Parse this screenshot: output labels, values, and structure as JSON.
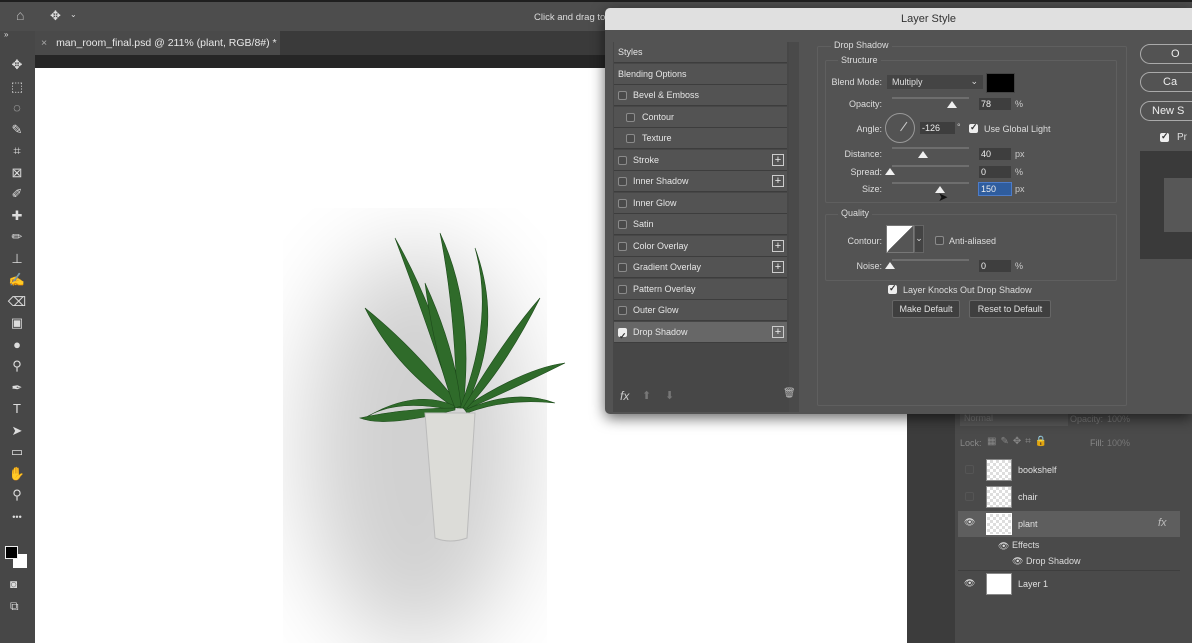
{
  "topbar": {
    "hint": "Click and drag to",
    "icons": [
      "home-icon",
      "move-icon",
      "chevron-down-icon"
    ]
  },
  "document_tab": {
    "close": "×",
    "title": "man_room_final.psd @ 211% (plant, RGB/8#) *"
  },
  "toolbar": {
    "expand": "»",
    "tools": [
      {
        "name": "move-tool",
        "glyph": "✥"
      },
      {
        "name": "marquee-tool",
        "glyph": "⬚"
      },
      {
        "name": "lasso-tool",
        "glyph": "◌"
      },
      {
        "name": "quick-select-tool",
        "glyph": "✎"
      },
      {
        "name": "crop-tool",
        "glyph": "⌗"
      },
      {
        "name": "frame-tool",
        "glyph": "⊠"
      },
      {
        "name": "eyedropper-tool",
        "glyph": "✐"
      },
      {
        "name": "healing-tool",
        "glyph": "✚"
      },
      {
        "name": "brush-tool",
        "glyph": "✏"
      },
      {
        "name": "stamp-tool",
        "glyph": "⊥"
      },
      {
        "name": "history-brush-tool",
        "glyph": "✍"
      },
      {
        "name": "eraser-tool",
        "glyph": "⌫"
      },
      {
        "name": "gradient-tool",
        "glyph": "▣"
      },
      {
        "name": "blur-tool",
        "glyph": "●"
      },
      {
        "name": "dodge-tool",
        "glyph": "⚲"
      },
      {
        "name": "pen-tool",
        "glyph": "✒"
      },
      {
        "name": "type-tool",
        "glyph": "T"
      },
      {
        "name": "path-select-tool",
        "glyph": "➤"
      },
      {
        "name": "rectangle-tool",
        "glyph": "▭"
      },
      {
        "name": "hand-tool",
        "glyph": "✋"
      },
      {
        "name": "zoom-tool",
        "glyph": "⚲"
      },
      {
        "name": "more-tools",
        "glyph": "•••"
      }
    ]
  },
  "dialog": {
    "title": "Layer Style",
    "styles_list": [
      {
        "label": "Styles",
        "type": "header"
      },
      {
        "label": "Blending Options",
        "type": "header"
      },
      {
        "label": "Bevel & Emboss",
        "checked": false,
        "indent": false,
        "plus": false
      },
      {
        "label": "Contour",
        "checked": false,
        "indent": true,
        "plus": false
      },
      {
        "label": "Texture",
        "checked": false,
        "indent": true,
        "plus": false
      },
      {
        "label": "Stroke",
        "checked": false,
        "indent": false,
        "plus": true
      },
      {
        "label": "Inner Shadow",
        "checked": false,
        "indent": false,
        "plus": true
      },
      {
        "label": "Inner Glow",
        "checked": false,
        "indent": false,
        "plus": false
      },
      {
        "label": "Satin",
        "checked": false,
        "indent": false,
        "plus": false
      },
      {
        "label": "Color Overlay",
        "checked": false,
        "indent": false,
        "plus": true
      },
      {
        "label": "Gradient Overlay",
        "checked": false,
        "indent": false,
        "plus": true
      },
      {
        "label": "Pattern Overlay",
        "checked": false,
        "indent": false,
        "plus": false
      },
      {
        "label": "Outer Glow",
        "checked": false,
        "indent": false,
        "plus": false
      },
      {
        "label": "Drop Shadow",
        "checked": true,
        "indent": false,
        "plus": true,
        "selected": true
      }
    ],
    "footer": {
      "fx": "fx",
      "up": "⬆",
      "down": "⬇",
      "trash": "🗑"
    },
    "drop_shadow": {
      "section": "Drop Shadow",
      "structure": "Structure",
      "blend_mode_label": "Blend Mode:",
      "blend_mode": "Multiply",
      "shadow_color": "#000000",
      "opacity_label": "Opacity:",
      "opacity": "78",
      "opacity_unit": "%",
      "angle_label": "Angle:",
      "angle": "-126",
      "angle_unit": "°",
      "use_global_light": "Use Global Light",
      "use_global_light_checked": true,
      "distance_label": "Distance:",
      "distance": "40",
      "distance_unit": "px",
      "spread_label": "Spread:",
      "spread": "0",
      "spread_unit": "%",
      "size_label": "Size:",
      "size": "150",
      "size_unit": "px",
      "quality": "Quality",
      "contour_label": "Contour:",
      "anti_aliased": "Anti-aliased",
      "anti_aliased_checked": false,
      "noise_label": "Noise:",
      "noise": "0",
      "noise_unit": "%",
      "knocks_out": "Layer Knocks Out Drop Shadow",
      "knocks_out_checked": true,
      "make_default": "Make Default",
      "reset_default": "Reset to Default"
    },
    "slider_levels": {
      "opacity": 78,
      "distance_fraction": 0.4,
      "spread": 0,
      "size_fraction": 0.6,
      "noise": 0
    },
    "buttons": {
      "ok": "O",
      "cancel": "Ca",
      "new_style": "New S",
      "preview": "Pr",
      "preview_checked": true
    }
  },
  "layers_panel": {
    "blend_mode": "Normal",
    "opacity_label": "Opacity:",
    "opacity": "100%",
    "lock_label": "Lock:",
    "fill_label": "Fill:",
    "fill": "100%",
    "layers": [
      {
        "name": "bookshelf",
        "visible": false
      },
      {
        "name": "chair",
        "visible": false
      },
      {
        "name": "plant",
        "visible": true,
        "selected": true,
        "fx": "fx"
      },
      {
        "name": "Layer 1",
        "visible": true
      }
    ],
    "effects_label": "Effects",
    "effect_item": "Drop Shadow"
  }
}
